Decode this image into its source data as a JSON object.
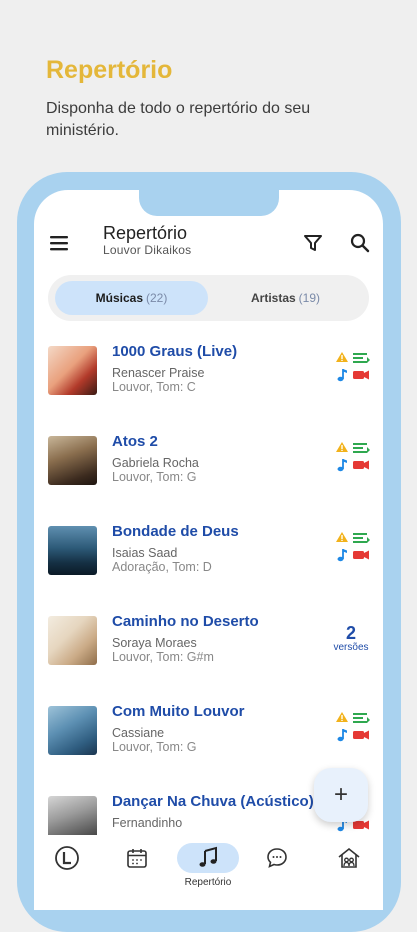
{
  "promo": {
    "title": "Repertório",
    "subtitle": "Disponha de todo o repertório do seu ministério."
  },
  "header": {
    "title": "Repertório",
    "subtitle": "Louvor Dikaikos"
  },
  "tabs": [
    {
      "label": "Músicas",
      "count": "(22)",
      "active": true
    },
    {
      "label": "Artistas",
      "count": "(19)",
      "active": false
    }
  ],
  "songs": [
    {
      "title": "1000 Graus (Live)",
      "artist": "Renascer Praise",
      "meta": "Louvor, Tom: C",
      "versions": null
    },
    {
      "title": "Atos 2",
      "artist": "Gabriela Rocha",
      "meta": "Louvor, Tom: G",
      "versions": null
    },
    {
      "title": "Bondade de Deus",
      "artist": "Isaias Saad",
      "meta": "Adoração, Tom: D",
      "versions": null
    },
    {
      "title": "Caminho no Deserto",
      "artist": "Soraya Moraes",
      "meta": "Louvor, Tom: G#m",
      "versions": "2",
      "versions_label": "versões"
    },
    {
      "title": "Com Muito Louvor",
      "artist": "Cassiane",
      "meta": "Louvor, Tom: G",
      "versions": null
    },
    {
      "title": "Dançar Na Chuva (Acústico)",
      "artist": "Fernandinho",
      "meta": "",
      "versions": null
    }
  ],
  "fab": {
    "label": "+"
  },
  "nav": [
    {
      "name": "nav-home",
      "icon": "logo-icon",
      "label": ""
    },
    {
      "name": "nav-calendar",
      "icon": "calendar-icon",
      "label": ""
    },
    {
      "name": "nav-repertorio",
      "icon": "music-notes-icon",
      "label": "Repertório",
      "active": true
    },
    {
      "name": "nav-chat",
      "icon": "chat-bubble-icon",
      "label": ""
    },
    {
      "name": "nav-team",
      "icon": "team-icon",
      "label": ""
    }
  ],
  "colors": {
    "accent_yellow": "#e4b73a",
    "title_blue": "#1f4ca8",
    "phone_frame": "#a9d2ef",
    "active_pill": "#cde3fa"
  }
}
